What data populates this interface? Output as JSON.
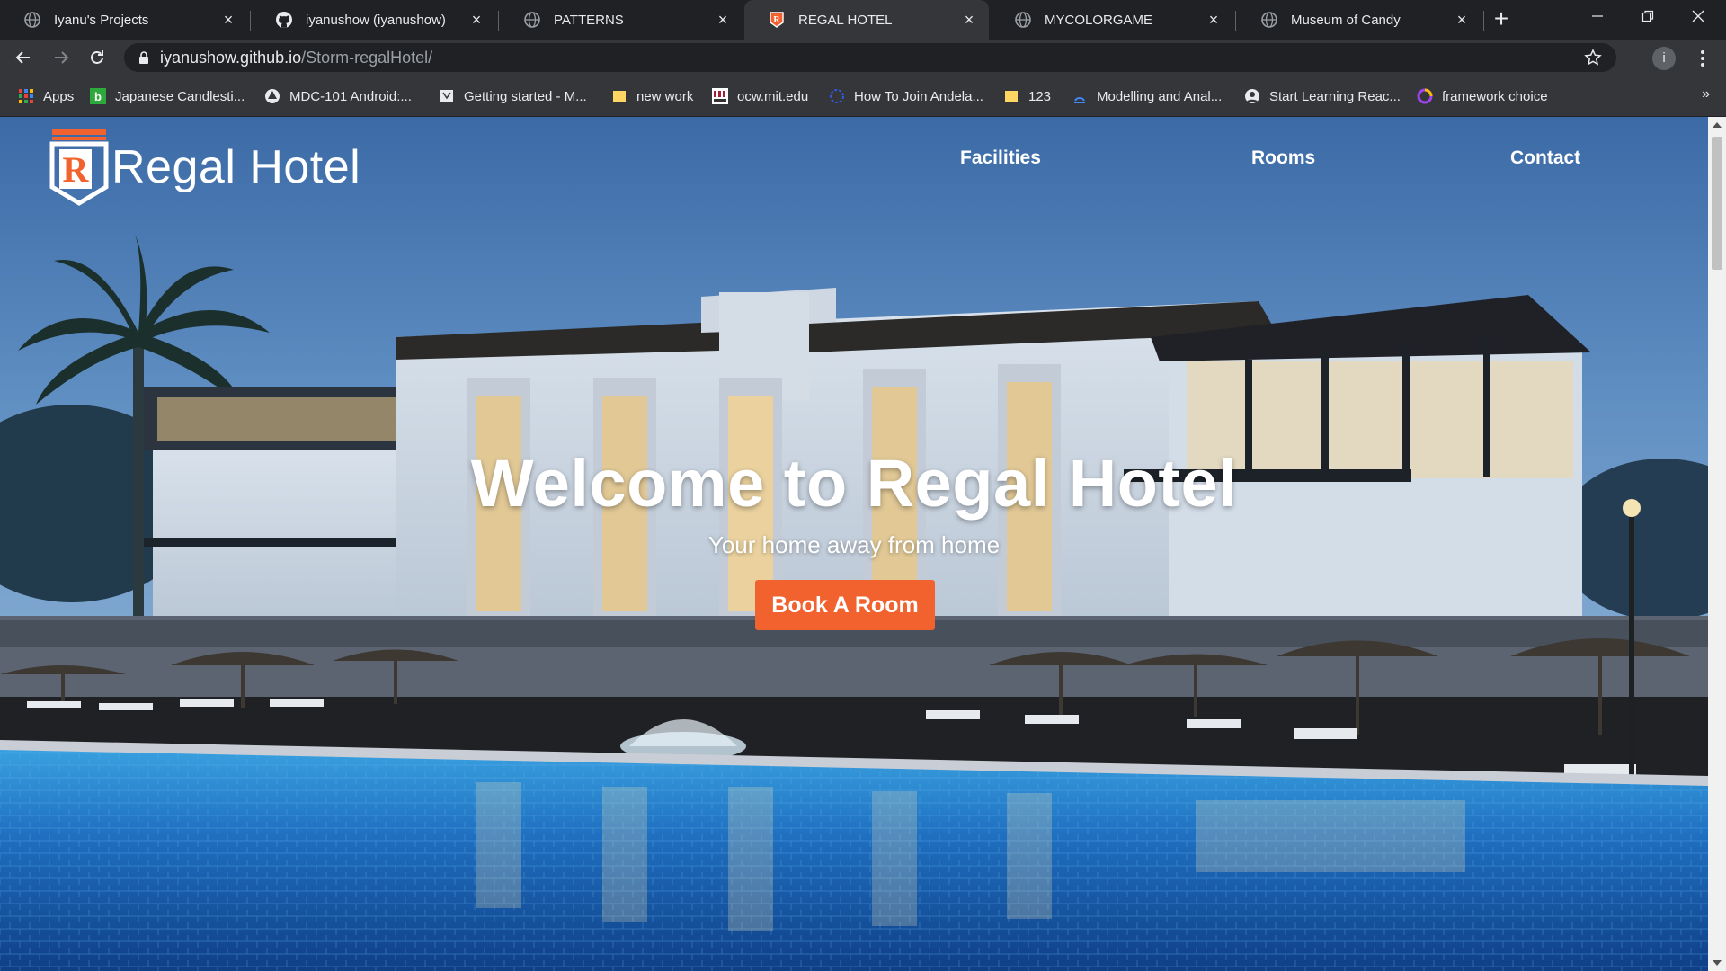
{
  "browser": {
    "tabs": [
      {
        "title": "Iyanu's Projects",
        "icon": "globe-icon"
      },
      {
        "title": "iyanushow (iyanushow)",
        "icon": "github-icon"
      },
      {
        "title": "PATTERNS",
        "icon": "globe-icon"
      },
      {
        "title": "REGAL HOTEL",
        "icon": "regal-hotel-favicon",
        "active": true
      },
      {
        "title": "MYCOLORGAME",
        "icon": "globe-icon"
      },
      {
        "title": "Museum of Candy",
        "icon": "globe-icon"
      }
    ],
    "address": {
      "host": "iyanushow.github.io",
      "path": "/Storm-regalHotel/"
    },
    "profile_initial": "i",
    "bookmarks": [
      {
        "label": "Apps",
        "icon": "apps-grid-icon"
      },
      {
        "label": "Japanese Candlesti...",
        "icon": "b-icon"
      },
      {
        "label": "MDC-101 Android:...",
        "icon": "material-icon"
      },
      {
        "label": "Getting started - M...",
        "icon": "page-icon"
      },
      {
        "label": "new work",
        "icon": "folder-icon"
      },
      {
        "label": "ocw.mit.edu",
        "icon": "mit-icon"
      },
      {
        "label": "How To Join Andela...",
        "icon": "andela-icon"
      },
      {
        "label": "123",
        "icon": "folder-icon"
      },
      {
        "label": "Modelling and Anal...",
        "icon": "bookmark-icon"
      },
      {
        "label": "Start Learning Reac...",
        "icon": "person-icon"
      },
      {
        "label": "framework choice",
        "icon": "circle-icon"
      }
    ],
    "bookmarks_overflow": "»"
  },
  "site": {
    "logo_letter": "R",
    "logo_text": "Regal Hotel",
    "nav": [
      "Facilities",
      "Rooms",
      "Contact"
    ],
    "headline": "Welcome to Regal Hotel",
    "subline": "Your home away from home",
    "cta_label": "Book A Room"
  },
  "colors": {
    "accent": "#f2622e",
    "browser_dark": "#202124",
    "browser_toolbar": "#35363a"
  }
}
